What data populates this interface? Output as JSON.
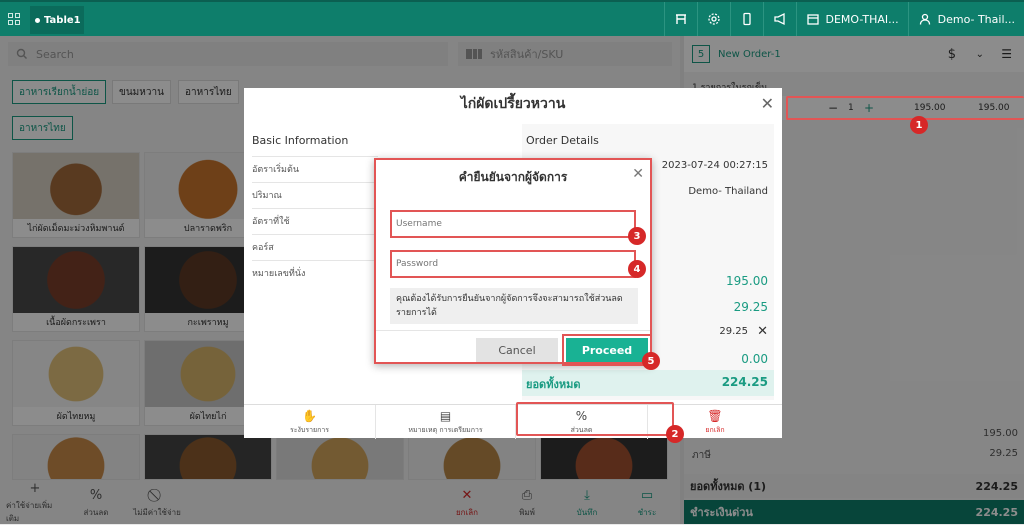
{
  "topbar": {
    "tab_label": "Table1",
    "shop_label": "DEMO-THAI...",
    "user_label": "Demo- Thail...",
    "icons": [
      "table-icon",
      "gear-icon",
      "mobile-icon",
      "megaphone-icon",
      "store-icon",
      "user-icon"
    ]
  },
  "search": {
    "placeholder": "Search",
    "sku_placeholder": "รหัสสินค้า/SKU"
  },
  "categories": [
    "อาหารเรียกน้ำย่อย",
    "ขนมหวาน",
    "อาหารไทย",
    "อาหารไทย"
  ],
  "menu_items": [
    {
      "name": "ไก่ผัดเม็ดมะม่วงหิมพานต์"
    },
    {
      "name": "ปลาราดพริก"
    },
    {
      "name": "เนื้อผัดกระเพรา"
    },
    {
      "name": "กะเพราหมู"
    },
    {
      "name": "ผัดไทยหมู"
    },
    {
      "name": "ผัดไทยไก่"
    }
  ],
  "bottom_left": {
    "add_expense": "ค่าใช้จ่ายเพิ่มเติม",
    "discount": "ส่วนลด",
    "no_expense": "ไม่มีค่าใช้จ่าย",
    "cancel": "ยกเลิก",
    "print": "พิมพ์",
    "save": "บันทึก",
    "payment": "ชำระ"
  },
  "order": {
    "number": "5",
    "title": "New Order-1",
    "currency_symbol": "$",
    "items_header": "1 รายการในรถเข็น",
    "line_qty": "1",
    "line_price": "195.00",
    "line_total": "195.00",
    "subtotal": "195.00",
    "tax_label": "ภาษี",
    "tax": "29.25",
    "total_label": "ยอดทั้งหมด  (1)",
    "total": "224.25",
    "pay_label": "ชำระเงินด่วน",
    "pay_total": "224.25"
  },
  "product_modal": {
    "title": "ไก่ผัดเปรี้ยวหวาน",
    "basic_info": "Basic Information",
    "fields": [
      "อัตราเริ่มต้น",
      "ปริมาณ",
      "อัตราที่ใช้",
      "คอร์ส",
      "หมายเลขที่นั่ง"
    ],
    "order_details": "Order Details",
    "datetime": "2023-07-24 00:27:15",
    "staff": "Demo- Thailand",
    "price": "195.00",
    "tax": "29.25",
    "tax_editable": "29.25",
    "discount": "0.00",
    "grand_total_label": "ยอดทั้งหมด",
    "grand_total": "224.25",
    "actions": {
      "pause": "ระงับรายการ",
      "note": "หมายเหตุ การเตรียมการ",
      "discount_symbol": "%",
      "discount": "ส่วนลด",
      "cancel": "ยกเลิก"
    }
  },
  "confirm_modal": {
    "title": "คำยืนยันจากผู้จัดการ",
    "username_placeholder": "Username",
    "password_placeholder": "Password",
    "note": "คุณต้องได้รับการยืนยันจากผู้จัดการจึงจะสามารถใช้ส่วนลดรายการได้",
    "cancel": "Cancel",
    "proceed": "Proceed"
  },
  "badges": [
    "1",
    "2",
    "3",
    "4",
    "5"
  ],
  "colors": {
    "primary": "#0e7e6b",
    "accent": "#19b294",
    "annotation": "#e25555",
    "danger": "#d62828"
  }
}
